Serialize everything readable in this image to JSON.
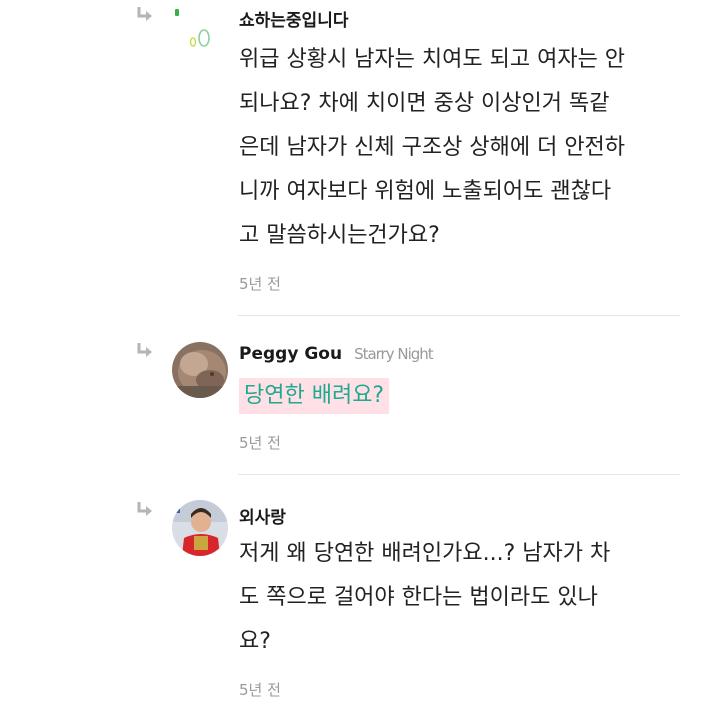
{
  "comments": [
    {
      "author": "쇼하는중입니다",
      "nickname": "",
      "avatar_icon": "logo-avatar",
      "lines": [
        "위급 상황시 남자는 치여도 되고 여자는 안",
        "되나요? 차에 치이면 중상 이상인거 똑같",
        "은데 남자가 신체 구조상 상해에 더 안전하",
        "니까 여자보다 위험에 노출되어도 괜찮다",
        "고 말씀하시는건가요?"
      ],
      "time": "5년 전"
    },
    {
      "author": "Peggy Gou",
      "nickname": "Starry Night",
      "avatar_icon": "puppy-avatar",
      "highlight": "당연한 배려요?",
      "time": "5년 전"
    },
    {
      "author": "외사랑",
      "nickname": "",
      "avatar_icon": "person-avatar",
      "lines": [
        "저게 왜 당연한 배려인가요...? 남자가 차",
        "도 쪽으로 걸어야 한다는 법이라도 있나",
        "요?"
      ],
      "time": "5년 전"
    }
  ],
  "colors": {
    "highlight_bg": "#ffe0e6",
    "highlight_text": "#1fa98f",
    "meta": "#9a9a9a"
  }
}
